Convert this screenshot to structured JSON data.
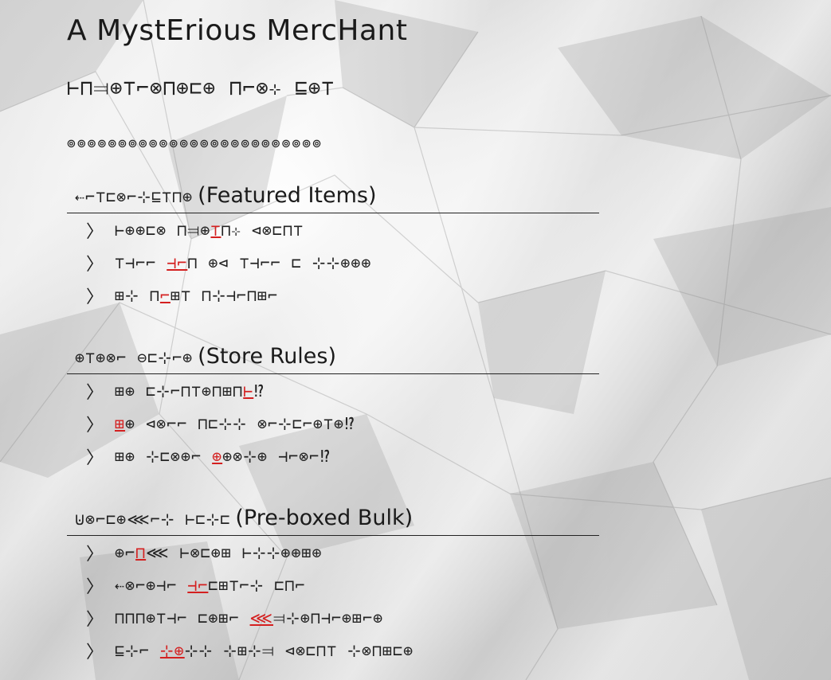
{
  "title": "A MystErious MercHant",
  "subtitle_glyphs": "⊢⊓⫤⊕⊤⌐⊗⊓⊕⊏⊕ ⊓⌐⊗⊹ ⊑⊕⊤",
  "divider_glyphs": "⊚⊚⊚⊚⊚⊚⊚⊚⊚⊚⊚⊚⊚⊚⊚⊚⊚⊚⊚⊚⊚⊚⊚⊚⊚",
  "sections": [
    {
      "heading_glyphs": "⇠⌐⊤⊏⊗⌐⊹⊑⊤⊓⊕",
      "heading_english": "(Featured Items)",
      "items": [
        {
          "before": "⊢⊕⊕⊏⊗ ⊓⫤⊕",
          "hl": "⊤",
          "after": "⊓⊹ ⊲⊗⊏⊓⊤"
        },
        {
          "before": "⊤⊣⌐⌐ ",
          "hl": "⊣⌐",
          "after": "⊓ ⊕⊲ ⊤⊣⌐⌐ ⊏ ⊹⊹⊕⊕⊕"
        },
        {
          "before": "⊞⊹ ⊓",
          "hl": "⌐",
          "after": "⊞⊤ ⊓⊹⊣⌐⊓⊞⌐"
        }
      ]
    },
    {
      "heading_glyphs": "⊕⊤⊕⊗⌐ ⊖⊏⊹⌐⊕",
      "heading_english": "(Store Rules)",
      "items": [
        {
          "before": "⊞⊕ ⊏⊹⌐⊓⊤⊕⊓⊞⊓",
          "hl": "⊢",
          "after": "⁉"
        },
        {
          "before": "",
          "hl": "⊞",
          "after": "⊕ ⊲⊗⌐⌐ ⊓⊏⊹⊹ ⊗⌐⊹⊏⌐⊕⊤⊕⁉"
        },
        {
          "before": "⊞⊕ ⊹⊏⊗⊕⌐ ",
          "hl": "⊕",
          "after": "⊕⊗⊹⊕ ⊣⌐⊗⌐⁉"
        }
      ]
    },
    {
      "heading_glyphs": "⊍⊗⌐⊏⊕⋘⌐⊹ ⊢⊏⊹⊏",
      "heading_english": "(Pre-boxed Bulk)",
      "items": [
        {
          "before": "⊕⌐",
          "hl": "⊓",
          "after": "⋘ ⊢⊗⊏⊕⊞ ⊢⊹⊹⊕⊕⊞⊕"
        },
        {
          "before": "⇠⊗⌐⊕⊣⌐ ",
          "hl": "⊣⌐",
          "after": "⊏⊞⊤⌐⊹ ⊏⊓⌐"
        },
        {
          "before": "⊓⊓⊓⊕⊤⊣⌐ ⊏⊕⊞⌐ ",
          "hl": "⋘",
          "after": "⫤⊹⊕⊓⊣⌐⊕⊞⌐⊕"
        },
        {
          "before": "⊑⊹⌐ ",
          "hl": "⊹⊕",
          "after": "⊹⊹ ⊹⊞⊹⫤ ⊲⊗⊏⊓⊤ ⊹⊗⊓⊞⊏⊕"
        }
      ]
    }
  ]
}
